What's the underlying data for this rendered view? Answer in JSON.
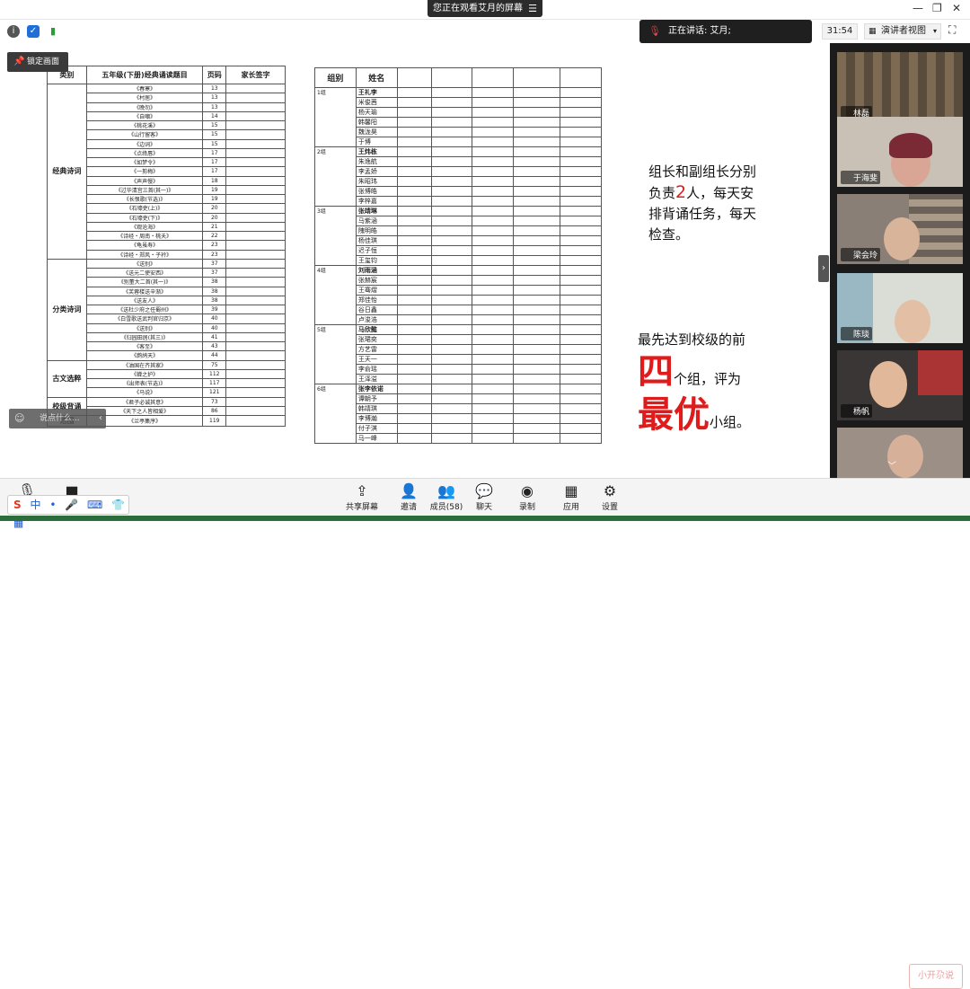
{
  "top": {
    "share_banner": "您正在观看艾月的屏幕",
    "speaking": "正在讲话: 艾月;",
    "timer": "31:54",
    "view_mode": "演讲者视图",
    "lock_screen": "锁定画面"
  },
  "table1": {
    "headers": [
      "类别",
      "五年级(下册)经典诵读题目",
      "页码",
      "家长签字"
    ],
    "sections": [
      {
        "category": "经典诗词",
        "rows": [
          [
            "《春寒》",
            "13"
          ],
          [
            "《村居》",
            "13"
          ],
          [
            "《晚勿》",
            "13"
          ],
          [
            "《自嘲》",
            "14"
          ],
          [
            "《桃花溪》",
            "15"
          ],
          [
            "《山行留客》",
            "15"
          ],
          [
            "《边词》",
            "15"
          ],
          [
            "《点绛唇》",
            "17"
          ],
          [
            "《如梦令》",
            "17"
          ],
          [
            "《一剪梅》",
            "17"
          ],
          [
            "《声声慢》",
            "18"
          ],
          [
            "《过华清宫三首(其一)》",
            "19"
          ],
          [
            "《长恨歌(节选)》",
            "19"
          ],
          [
            "《石壕吏(上)》",
            "20"
          ],
          [
            "《石壕吏(下)》",
            "20"
          ],
          [
            "《观沧海》",
            "21"
          ],
          [
            "《诗经・周南・桃夭》",
            "22"
          ],
          [
            "《龟虽寿》",
            "23"
          ],
          [
            "《诗经・郑风・子衿》",
            "23"
          ]
        ]
      },
      {
        "category": "分类诗词",
        "rows": [
          [
            "《送别》",
            "37"
          ],
          [
            "《送元二使安西》",
            "37"
          ],
          [
            "《别董大二首(其一)》",
            "38"
          ],
          [
            "《芙蓉楼送辛渐》",
            "38"
          ],
          [
            "《送友人》",
            "38"
          ],
          [
            "《送杜少府之任蜀州》",
            "39"
          ],
          [
            "《白雪歌送武判官归京》",
            "40"
          ],
          [
            "《送别》",
            "40"
          ],
          [
            "《归园田居(其三)》",
            "41"
          ],
          [
            "《客至》",
            "43"
          ],
          [
            "《鹧鸪天》",
            "44"
          ]
        ]
      },
      {
        "category": "古文选粹",
        "rows": [
          [
            "《油国在齐其家》",
            "75"
          ],
          [
            "《蝉之护》",
            "112"
          ],
          [
            "《出师表(节选)》",
            "117"
          ],
          [
            "《马说》",
            "121"
          ]
        ]
      },
      {
        "category": "校级背诵",
        "rows": [
          [
            "《君子必诚其意》",
            "73"
          ],
          [
            "《天下之人皆相爱》",
            "86"
          ]
        ]
      },
      {
        "category": "范围",
        "rows": [
          [
            "《兰亭集序》",
            "119"
          ]
        ]
      }
    ]
  },
  "table2": {
    "headers": [
      "组别",
      "姓名"
    ],
    "groups": [
      {
        "group": "1组",
        "members": [
          "王礼李",
          "米俊茜",
          "杨天瑜",
          "韩馨阳",
          "魏泷昊",
          "于博"
        ]
      },
      {
        "group": "2组",
        "members": [
          "王炜栋",
          "朱逸航",
          "李孟娇",
          "朱昭玮",
          "张博皓",
          "李梓嘉"
        ]
      },
      {
        "group": "3组",
        "members": [
          "张靖琳",
          "马紫涵",
          "隗明皓",
          "杨佳琪",
          "迟子恒",
          "王玺钧"
        ]
      },
      {
        "group": "4组",
        "members": [
          "刘雨涵",
          "张赫宸",
          "王骞熠",
          "郑佳怡",
          "谷日鑫",
          "卢浚浩"
        ]
      },
      {
        "group": "5组",
        "members": [
          "马欣懿",
          "张珺奕",
          "方艺雷",
          "王天一",
          "李俞瑶",
          "王泽溢"
        ]
      },
      {
        "group": "6组",
        "members": [
          "张李依诺",
          "谭朝予",
          "韩靖琪",
          "李博瀚",
          "付子淇",
          "马一峰"
        ]
      }
    ]
  },
  "notes": {
    "n1_a": "组长和副组长分别",
    "n1_b": "负责",
    "n1_num": "2",
    "n1_c": "人，每天安",
    "n1_d": "排背诵任务，每天",
    "n1_e": "检查。",
    "n2_a": "最先达到校级的前",
    "n2_big1": "四",
    "n2_b": "个组，评为",
    "n2_big2": "最优",
    "n2_c": "小组。"
  },
  "chat_placeholder": "说点什么...",
  "participants": [
    "林磊",
    "于海斐",
    "梁会玲",
    "陈琰",
    "杨帆"
  ],
  "toolbar": {
    "share": "共享屏幕",
    "invite": "邀请",
    "members": "成员(58)",
    "chat": "聊天",
    "record": "录制",
    "apps": "应用",
    "settings": "设置"
  },
  "ime": {
    "lang": "中"
  },
  "watermark": "小开尕说",
  "colors": {
    "accent_red": "#e01b1b",
    "gallery_bg": "#1b1b1b"
  }
}
